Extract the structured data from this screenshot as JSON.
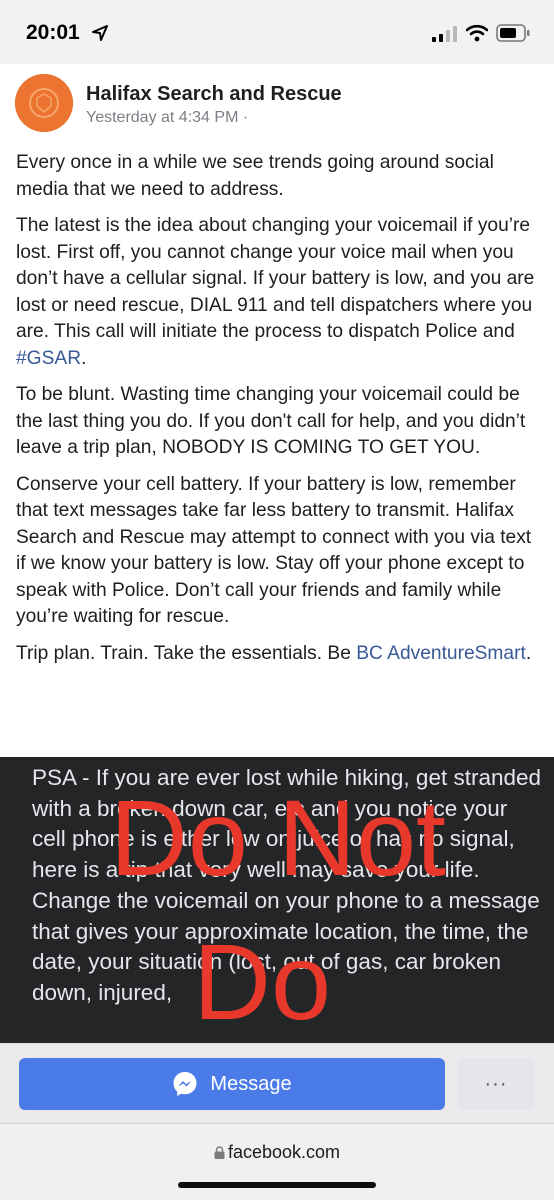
{
  "status_bar": {
    "time": "20:01"
  },
  "post": {
    "page_name": "Halifax Search and Rescue",
    "timestamp": "Yesterday at 4:34 PM ·",
    "paragraph_1": "Every once in a while we see trends going around social media that we need to address.",
    "paragraph_2_text": "The latest is the idea about changing your voicemail if you’re lost. First off, you cannot change your voice mail when you don’t have a cellular signal. If your battery is low, and you are lost or need rescue, DIAL 911 and tell dispatchers where you are. This call will initiate the process to dispatch Police and ",
    "paragraph_2_hashtag": "#GSAR",
    "paragraph_2_end": ".",
    "paragraph_3": "To be blunt. Wasting time changing your voicemail could be the last thing you do. If you don't call for help, and you didn’t leave a trip plan, NOBODY IS COMING TO GET YOU.",
    "paragraph_4": "Conserve your cell battery. If your battery is low, remember that text messages take far less battery to transmit. Halifax Search and Rescue may attempt to connect with you via text if we know your battery is low. Stay off your phone except to speak with Police. Don’t call your friends and family while you’re waiting for rescue.",
    "paragraph_5_text": "Trip plan. Train. Take the essentials. Be ",
    "paragraph_5_link": "BC AdventureSmart",
    "paragraph_5_end": "."
  },
  "shared_image": {
    "text": "PSA - If you are ever lost while hiking, get stranded with a broken down car, etc and you notice your cell phone is either low on juice or has no signal, here is a tip that very well may save your life. Change the voicemail on your phone to a message that gives your approximate location, the time, the date, your situation (lost, out of gas, car broken down, injured,",
    "overlay_line_1": "Do Not",
    "overlay_line_2": "Do",
    "overlay_color": "#e8382c"
  },
  "action_bar": {
    "message_label": "Message",
    "more_label": "···"
  },
  "browser": {
    "url": "facebook.com"
  },
  "colors": {
    "messenger_blue": "#4a7be8",
    "link": "#385898",
    "avatar": "#ec7430"
  }
}
